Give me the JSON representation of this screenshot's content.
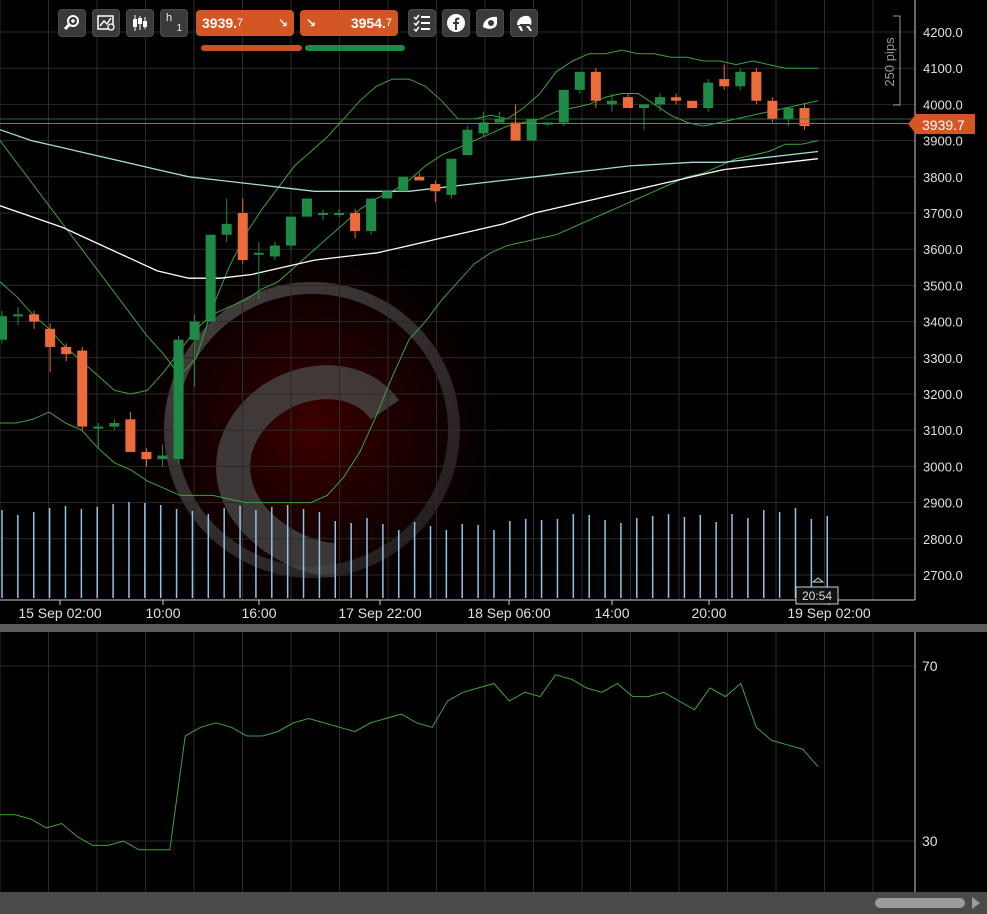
{
  "toolbar": {
    "timeframe_letter": "h",
    "timeframe_number": "1",
    "sell": {
      "price_main": "3939.",
      "price_sub": "7",
      "arrow": "↘",
      "color": "#d35624",
      "underline_color": "#c8511f"
    },
    "buy": {
      "price_main": "3954.",
      "price_sub": "7",
      "arrow": "↘",
      "color": "#d35624",
      "underline_color": "#1f8a46"
    },
    "icons": [
      "zoom-in-icon",
      "chart-settings-icon",
      "candlestick-icon",
      "timeframe-h1",
      "sell-price",
      "buy-price",
      "checklist-icon",
      "facebook-icon",
      "camera-icon",
      "helmet-icon"
    ]
  },
  "scale_label": "250 pips",
  "current_price_label": "3939.7",
  "time_box": "20:54",
  "colors": {
    "bull": "#1f8a46",
    "bear": "#ec6b3a",
    "volume": "#8fc4e6",
    "bollinger": "#3da33d",
    "ma_white": "#ffffff",
    "ma_cyan": "#a5dcd5",
    "rsi": "#3da33d",
    "price_line": "#d35624",
    "grid": "#2a2a2a"
  },
  "chart_data": [
    {
      "type": "candlestick",
      "title": "",
      "x": [
        "c1",
        "c2",
        "c3",
        "c4",
        "c5",
        "c6",
        "c7",
        "c8",
        "c9",
        "c10",
        "c11",
        "c12",
        "c13",
        "c14",
        "c15",
        "c16",
        "c17",
        "c18",
        "c19",
        "c20",
        "c21",
        "c22",
        "c23",
        "c24",
        "c25",
        "c26",
        "c27",
        "c28",
        "c29",
        "c30",
        "c31",
        "c32",
        "c33",
        "c34",
        "c35",
        "c36",
        "c37",
        "c38",
        "c39",
        "c40",
        "c41",
        "c42",
        "c43",
        "c44",
        "c45",
        "c46",
        "c47",
        "c48",
        "c49",
        "c50",
        "c51"
      ],
      "x_tick_labels": [
        "15 Sep 02:00",
        "10:00",
        "16:00",
        "17 Sep 22:00",
        "18 Sep 06:00",
        "14:00",
        "20:00",
        "19 Sep 02:00"
      ],
      "y_tick_labels": [
        "4200.0",
        "4100.0",
        "4000.0",
        "3900.0",
        "3800.0",
        "3700.0",
        "3600.0",
        "3500.0",
        "3400.0",
        "3300.0",
        "3200.0",
        "3100.0",
        "3000.0",
        "2900.0",
        "2800.0",
        "2700.0"
      ],
      "ylim": [
        2630,
        4250
      ],
      "ohlc": [
        [
          3350,
          3430,
          3340,
          3415
        ],
        [
          3415,
          3440,
          3390,
          3420
        ],
        [
          3420,
          3430,
          3380,
          3400
        ],
        [
          3380,
          3395,
          3260,
          3330
        ],
        [
          3330,
          3340,
          3290,
          3310
        ],
        [
          3320,
          3330,
          3100,
          3110
        ],
        [
          3110,
          3120,
          3050,
          3110
        ],
        [
          3110,
          3130,
          3100,
          3120
        ],
        [
          3130,
          3150,
          3040,
          3040
        ],
        [
          3040,
          3050,
          3000,
          3020
        ],
        [
          3020,
          3060,
          3000,
          3030
        ],
        [
          3020,
          3360,
          3010,
          3350
        ],
        [
          3350,
          3420,
          3220,
          3400
        ],
        [
          3400,
          3480,
          3400,
          3640
        ],
        [
          3640,
          3740,
          3620,
          3670
        ],
        [
          3700,
          3740,
          3560,
          3570
        ],
        [
          3590,
          3620,
          3460,
          3590
        ],
        [
          3580,
          3620,
          3570,
          3610
        ],
        [
          3610,
          3680,
          3600,
          3690
        ],
        [
          3690,
          3730,
          3690,
          3740
        ],
        [
          3700,
          3710,
          3680,
          3700
        ],
        [
          3700,
          3710,
          3690,
          3700
        ],
        [
          3700,
          3710,
          3630,
          3650
        ],
        [
          3650,
          3740,
          3640,
          3740
        ],
        [
          3740,
          3760,
          3740,
          3760
        ],
        [
          3760,
          3800,
          3760,
          3800
        ],
        [
          3800,
          3810,
          3790,
          3790
        ],
        [
          3780,
          3790,
          3730,
          3760
        ],
        [
          3750,
          3840,
          3740,
          3850
        ],
        [
          3860,
          3940,
          3860,
          3930
        ],
        [
          3920,
          3980,
          3910,
          3950
        ],
        [
          3950,
          3980,
          3950,
          3960
        ],
        [
          3950,
          4000,
          3900,
          3900
        ],
        [
          3900,
          3960,
          3900,
          3960
        ],
        [
          3950,
          3950,
          3940,
          3950
        ],
        [
          3950,
          4040,
          3940,
          4040
        ],
        [
          4040,
          4090,
          4030,
          4090
        ],
        [
          4090,
          4100,
          3990,
          4010
        ],
        [
          4000,
          4030,
          3980,
          4010
        ],
        [
          4020,
          4030,
          3990,
          3990
        ],
        [
          3990,
          4000,
          3930,
          4000
        ],
        [
          4000,
          4030,
          3980,
          4020
        ],
        [
          4020,
          4030,
          4000,
          4010
        ],
        [
          4010,
          4010,
          3990,
          3990
        ],
        [
          3990,
          4070,
          3980,
          4060
        ],
        [
          4070,
          4110,
          4040,
          4050
        ],
        [
          4050,
          4100,
          4040,
          4090
        ],
        [
          4090,
          4100,
          4000,
          4010
        ],
        [
          4010,
          4020,
          3950,
          3960
        ],
        [
          3960,
          3980,
          3940,
          3990
        ],
        [
          3990,
          4000,
          3930,
          3940
        ]
      ],
      "volume": [
        88,
        83,
        86,
        90,
        92,
        89,
        91,
        94,
        96,
        95,
        93,
        89,
        87,
        84,
        90,
        92,
        88,
        91,
        93,
        89,
        86,
        77,
        75,
        80,
        74,
        68,
        76,
        72,
        68,
        74,
        73,
        68,
        77,
        79,
        78,
        79,
        84,
        83,
        78,
        75,
        80,
        82,
        84,
        81,
        83,
        76,
        84,
        80,
        88,
        86,
        90,
        79,
        82
      ],
      "bollinger_upper": [
        3900,
        3840,
        3780,
        3720,
        3660,
        3600,
        3540,
        3480,
        3420,
        3360,
        3310,
        3250,
        3300,
        3440,
        3550,
        3640,
        3710,
        3770,
        3830,
        3870,
        3910,
        3960,
        4010,
        4050,
        4070,
        4070,
        4050,
        4010,
        3960,
        3960,
        3970,
        3960,
        3990,
        4030,
        4090,
        4120,
        4140,
        4140,
        4150,
        4140,
        4140,
        4130,
        4130,
        4120,
        4120,
        4110,
        4120,
        4110,
        4100,
        4100,
        4100
      ],
      "bollinger_middle": [
        3510,
        3470,
        3420,
        3380,
        3330,
        3290,
        3250,
        3210,
        3200,
        3210,
        3260,
        3320,
        3380,
        3420,
        3440,
        3460,
        3490,
        3510,
        3550,
        3590,
        3630,
        3670,
        3710,
        3740,
        3760,
        3790,
        3830,
        3860,
        3880,
        3900,
        3920,
        3940,
        3950,
        3960,
        3980,
        3990,
        4000,
        4020,
        4030,
        4030,
        4000,
        3970,
        3950,
        3940,
        3950,
        3960,
        3970,
        3980,
        3990,
        4000,
        4010
      ],
      "bollinger_lower": [
        3120,
        3120,
        3130,
        3150,
        3120,
        3100,
        3050,
        3010,
        2990,
        2960,
        2940,
        2920,
        2920,
        2920,
        2910,
        2900,
        2900,
        2900,
        2900,
        2900,
        2920,
        2970,
        3040,
        3140,
        3250,
        3350,
        3400,
        3460,
        3510,
        3560,
        3590,
        3610,
        3620,
        3630,
        3640,
        3660,
        3680,
        3700,
        3720,
        3740,
        3760,
        3780,
        3800,
        3810,
        3830,
        3850,
        3860,
        3870,
        3890,
        3890,
        3900
      ],
      "ma_white": [
        3720,
        3690,
        3660,
        3620,
        3580,
        3540,
        3520,
        3520,
        3530,
        3550,
        3570,
        3580,
        3590,
        3610,
        3630,
        3650,
        3670,
        3700,
        3720,
        3740,
        3760,
        3780,
        3800,
        3820,
        3830,
        3840,
        3850
      ],
      "ma_cyan": [
        3930,
        3900,
        3880,
        3860,
        3840,
        3820,
        3800,
        3790,
        3780,
        3770,
        3760,
        3760,
        3760,
        3760,
        3770,
        3780,
        3790,
        3800,
        3810,
        3820,
        3830,
        3835,
        3840,
        3840,
        3850,
        3860,
        3870
      ]
    },
    {
      "type": "line",
      "title": "",
      "y_tick_labels": [
        "70",
        "30"
      ],
      "ylim": [
        20,
        75
      ],
      "values": [
        36,
        36,
        35,
        33,
        34,
        31,
        29,
        29,
        30,
        28,
        28,
        28,
        54,
        56,
        57,
        56,
        54,
        54,
        55,
        57,
        58,
        57,
        56,
        55,
        57,
        58,
        59,
        57,
        56,
        62,
        64,
        65,
        66,
        62,
        64,
        63,
        68,
        67,
        65,
        64,
        66,
        63,
        63,
        64,
        62,
        60,
        65,
        63,
        66,
        56,
        53,
        52,
        51,
        47
      ]
    }
  ]
}
